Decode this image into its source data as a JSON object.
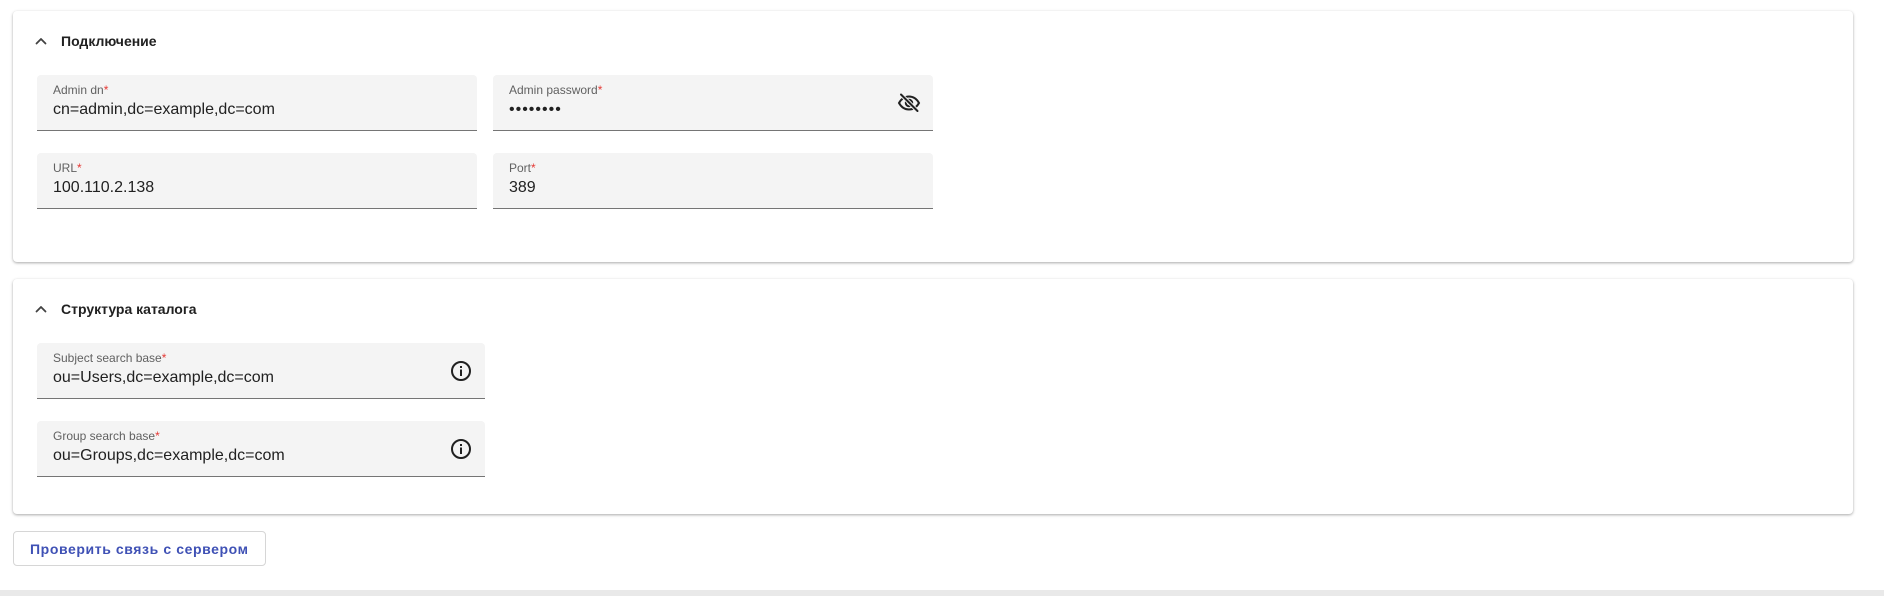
{
  "connection": {
    "title": "Подключение",
    "chevron_icon": "chevron-up-icon",
    "fields": {
      "admin_dn": {
        "label": "Admin dn",
        "required_mark": "*",
        "value": "cn=admin,dc=example,dc=com"
      },
      "admin_password": {
        "label": "Admin password",
        "required_mark": "*",
        "value": "••••••••",
        "icon": "eye-off-icon"
      },
      "url": {
        "label": "URL",
        "required_mark": "*",
        "value": "100.110.2.138"
      },
      "port": {
        "label": "Port",
        "required_mark": "*",
        "value": "389"
      }
    }
  },
  "structure": {
    "title": "Структура каталога",
    "chevron_icon": "chevron-up-icon",
    "fields": {
      "subject_search_base": {
        "label": "Subject search base",
        "required_mark": "*",
        "value": "ou=Users,dc=example,dc=com",
        "icon": "info-icon"
      },
      "group_search_base": {
        "label": "Group search base",
        "required_mark": "*",
        "value": "ou=Groups,dc=example,dc=com",
        "icon": "info-icon"
      }
    }
  },
  "actions": {
    "check_connection_label": "Проверить связь с сервером"
  },
  "colors": {
    "accent": "#3f51b5",
    "required": "#e53935",
    "field_bg": "#f4f4f4"
  }
}
